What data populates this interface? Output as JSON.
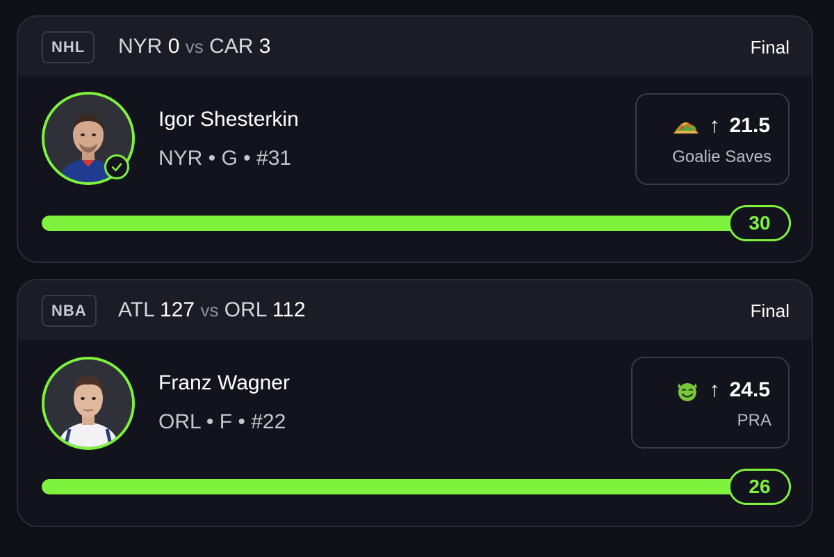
{
  "cards": [
    {
      "league": "NHL",
      "away_team": "NYR",
      "away_score": "0",
      "vs": "vs",
      "home_team": "CAR",
      "home_score": "3",
      "status": "Final",
      "player": {
        "name": "Igor Shesterkin",
        "meta": "NYR • G • #31",
        "verified": true
      },
      "prop": {
        "icon": "taco-icon",
        "direction": "↑",
        "line": "21.5",
        "stat": "Goalie Saves"
      },
      "result": {
        "value": "30",
        "progress": 1.0
      },
      "accent": "#7ef23d"
    },
    {
      "league": "NBA",
      "away_team": "ATL",
      "away_score": "127",
      "vs": "vs",
      "home_team": "ORL",
      "home_score": "112",
      "status": "Final",
      "player": {
        "name": "Franz Wagner",
        "meta": "ORL • F • #22",
        "verified": false
      },
      "prop": {
        "icon": "green-devil-face-icon",
        "direction": "↑",
        "line": "24.5",
        "stat": "PRA"
      },
      "result": {
        "value": "26",
        "progress": 1.0
      },
      "accent": "#7ef23d"
    }
  ]
}
